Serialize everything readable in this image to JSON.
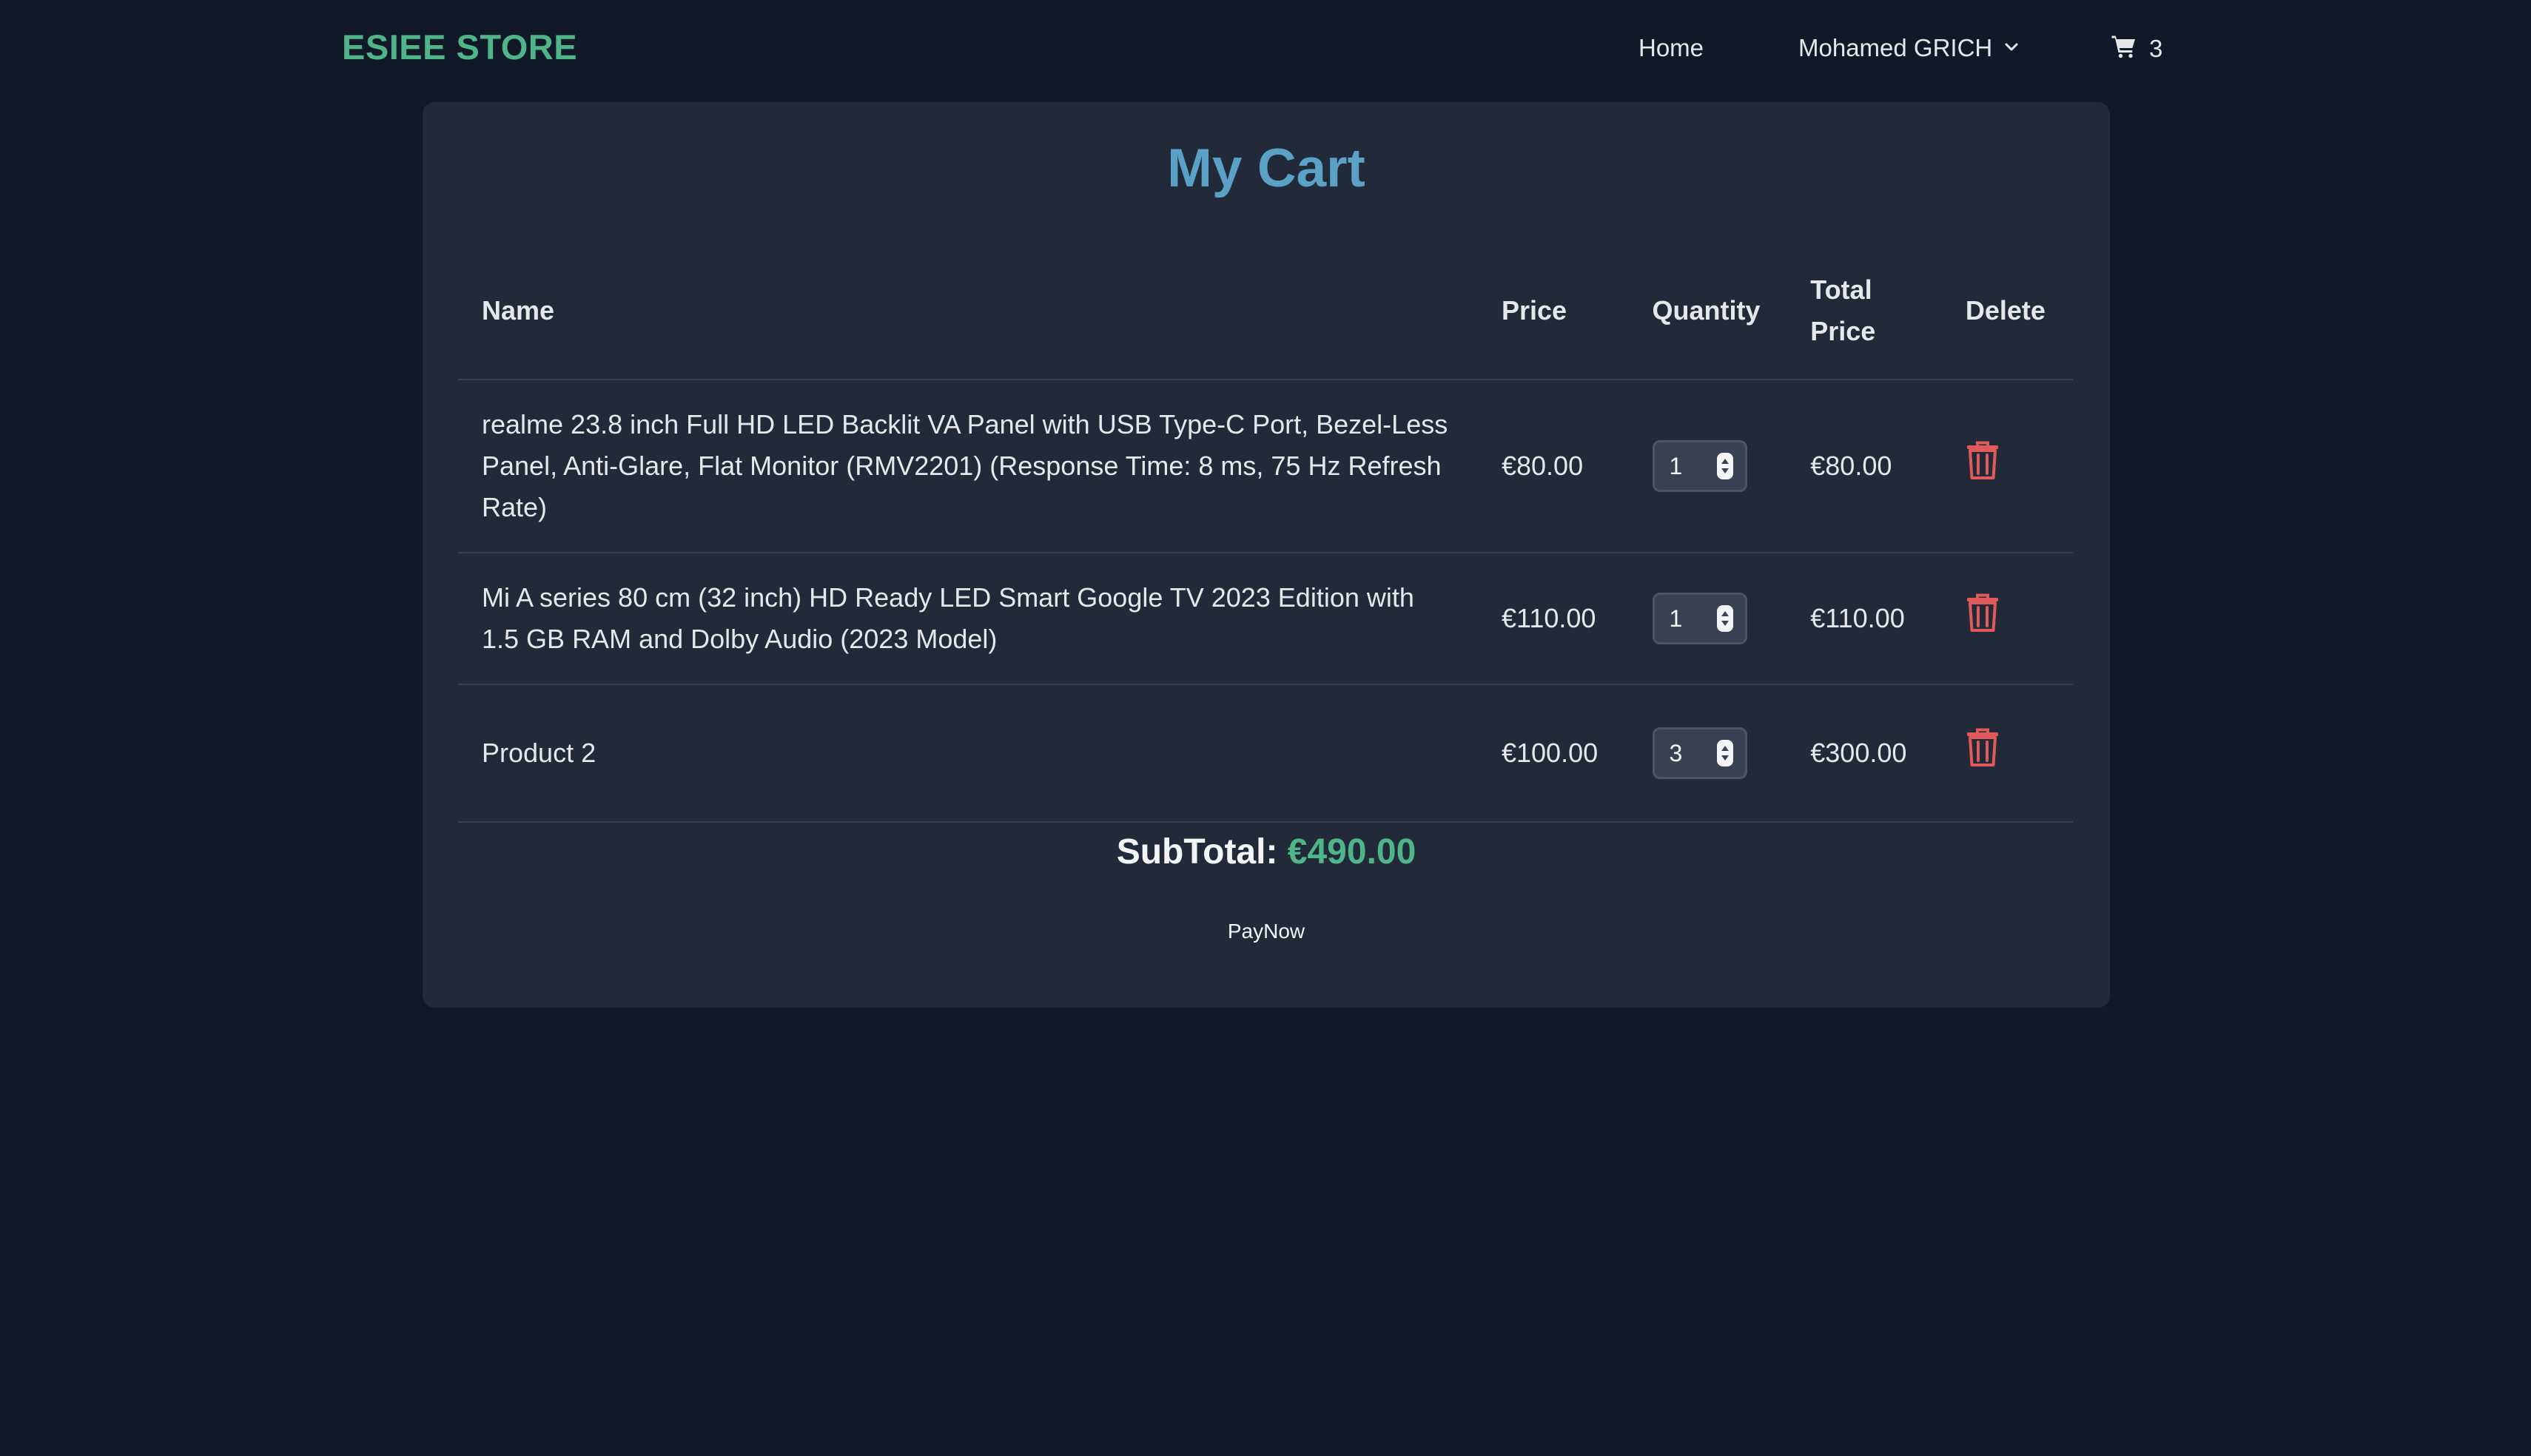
{
  "nav": {
    "brand": "ESIEE STORE",
    "home": "Home",
    "user": "Mohamed GRICH",
    "cart_count": "3"
  },
  "cart": {
    "title": "My Cart",
    "headers": {
      "name": "Name",
      "price": "Price",
      "quantity": "Quantity",
      "total_price": "Total Price",
      "delete": "Delete"
    },
    "items": [
      {
        "name": "realme 23.8 inch Full HD LED Backlit VA Panel with USB Type-C Port, Bezel-Less Panel, Anti-Glare, Flat Monitor (RMV2201) (Response Time: 8 ms, 75 Hz Refresh Rate)",
        "price": "€80.00",
        "quantity": "1",
        "total": "€80.00"
      },
      {
        "name": "Mi A series 80 cm (32 inch) HD Ready LED Smart Google TV 2023 Edition with 1.5 GB RAM and Dolby Audio (2023 Model)",
        "price": "€110.00",
        "quantity": "1",
        "total": "€110.00"
      },
      {
        "name": "Product 2",
        "price": "€100.00",
        "quantity": "3",
        "total": "€300.00"
      }
    ],
    "subtotal_label": "SubTotal:",
    "subtotal_value": "€490.00",
    "pay_label": "PayNow"
  },
  "icons": {
    "user_dropdown": "chevron-down-icon",
    "cart": "shopping-cart-icon",
    "delete": "trash-icon"
  },
  "colors": {
    "background": "#111827",
    "card": "#222938",
    "brand": "#4fb589",
    "title": "#5aa1c5",
    "delete": "#e05a5a"
  }
}
